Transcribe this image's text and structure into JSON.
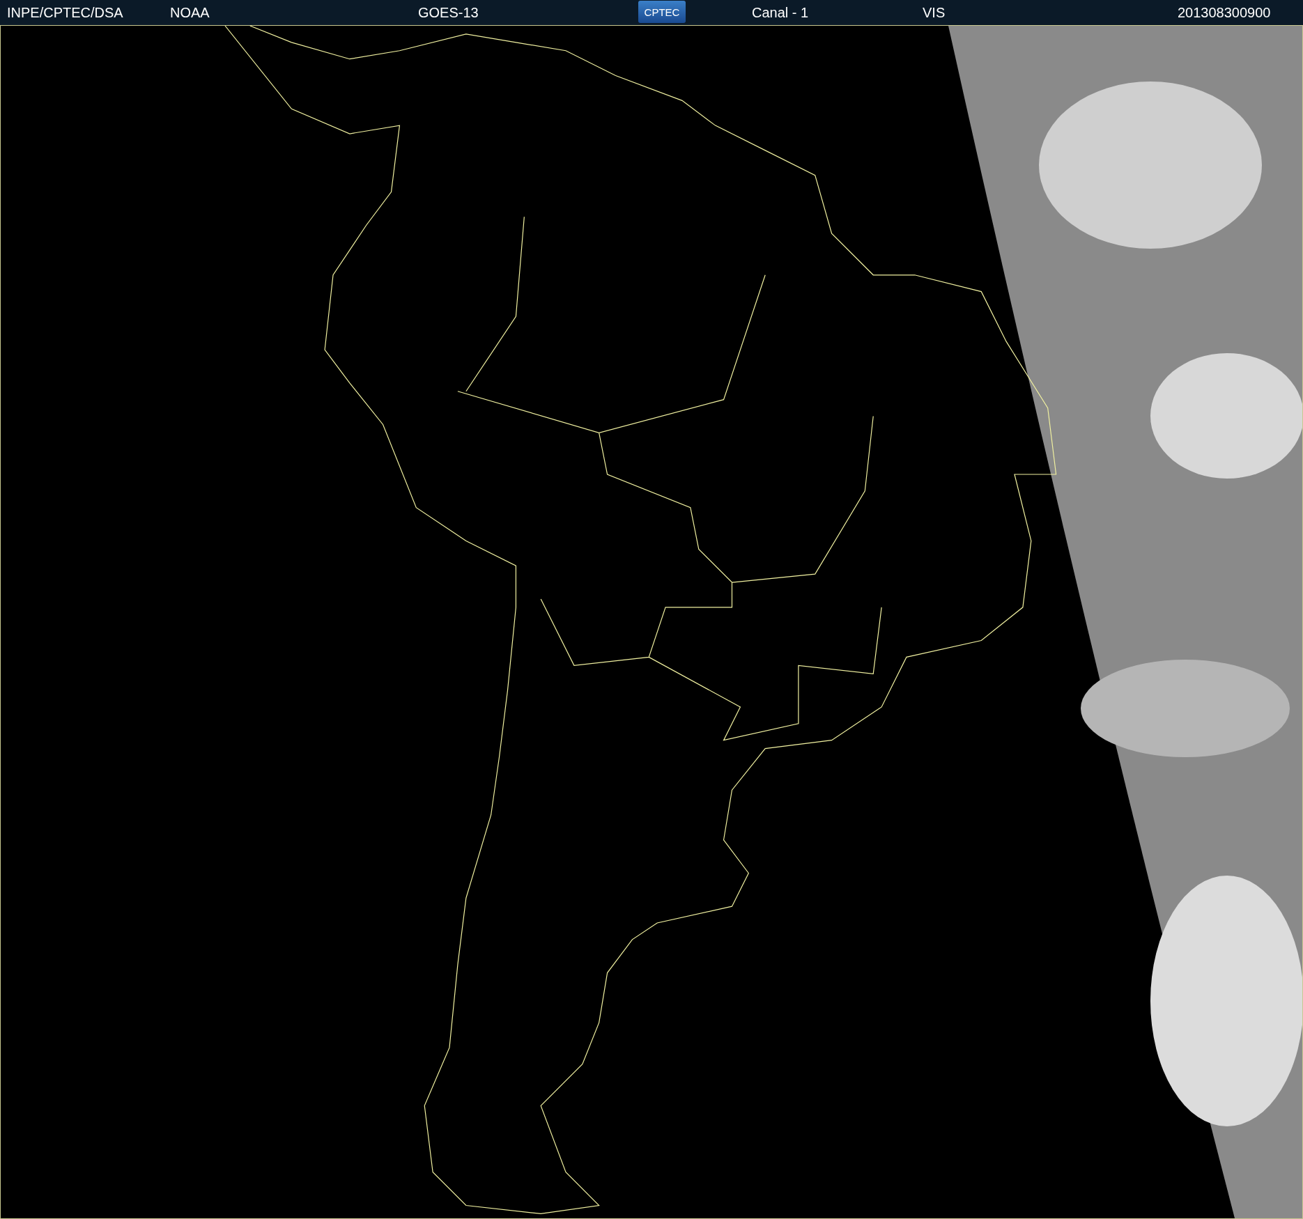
{
  "header": {
    "items": [
      {
        "kind": "text",
        "text": "INPE/CPTEC/DSA"
      },
      {
        "kind": "text",
        "text": "NOAA"
      },
      {
        "kind": "text",
        "text": "GOES-13"
      },
      {
        "kind": "logo",
        "text": "CPTEC"
      },
      {
        "kind": "text",
        "text": "Canal - 1"
      },
      {
        "kind": "text",
        "text": "VIS"
      },
      {
        "kind": "text",
        "text": "201308300900"
      }
    ]
  }
}
